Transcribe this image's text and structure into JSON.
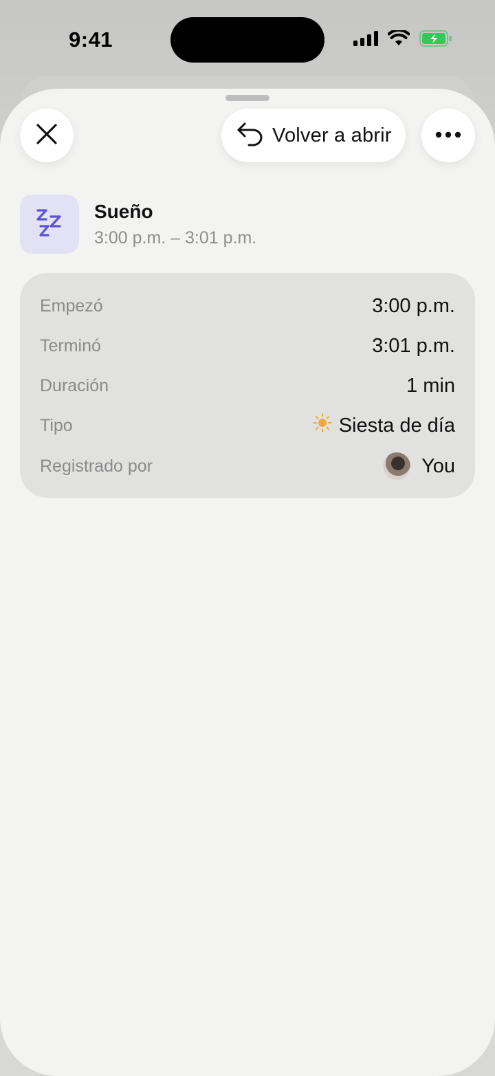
{
  "status_bar": {
    "time": "9:41"
  },
  "toolbar": {
    "reopen_label": "Volver a abrir"
  },
  "entry": {
    "title": "Sueño",
    "time_range": "3:00 p.m. – 3:01 p.m."
  },
  "details": [
    {
      "label": "Empezó",
      "value": "3:00 p.m."
    },
    {
      "label": "Terminó",
      "value": "3:01 p.m."
    },
    {
      "label": "Duración",
      "value": "1 min"
    },
    {
      "label": "Tipo",
      "value": "Siesta de día"
    },
    {
      "label": "Registrado por",
      "value": "You"
    }
  ],
  "colors": {
    "accent_purple": "#5b53d6",
    "tile_background": "#e3e2f5",
    "sun_orange": "#f2a93b",
    "battery_green": "#34c759"
  }
}
